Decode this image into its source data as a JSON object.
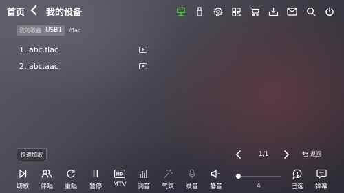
{
  "header": {
    "home_label": "首页",
    "page_title": "我的设备",
    "top_icons": [
      "usb-device-icon",
      "usb-stick-icon",
      "settings-icon",
      "qrcode-icon",
      "cart-icon",
      "download-box-icon",
      "mail-icon",
      "search-icon",
      "power-icon"
    ],
    "active_icon_color": "#4cd137"
  },
  "breadcrumb": {
    "seg1": "我的歌曲",
    "seg2": "USB1",
    "path": "/flac"
  },
  "files": [
    {
      "label": "1.  abc.flac"
    },
    {
      "label": "2.  abc.aac"
    }
  ],
  "quick_add": "快速加歌",
  "pager": {
    "text": "1/1"
  },
  "back_label": "返回",
  "bottom_bar": {
    "items": [
      {
        "label": "切歌",
        "icon": "next-track-icon"
      },
      {
        "label": "伴唱",
        "icon": "duet-icon"
      },
      {
        "label": "重唱",
        "icon": "replay-icon"
      },
      {
        "label": "暂停",
        "icon": "pause-icon"
      },
      {
        "label": "MTV",
        "icon": "hd-icon"
      },
      {
        "label": "调音",
        "icon": "equalizer-icon"
      },
      {
        "label": "气氛",
        "icon": "magic-wand-icon"
      },
      {
        "label": "录音",
        "icon": "microphone-icon"
      },
      {
        "label": "静音",
        "icon": "mute-icon"
      }
    ],
    "volume": {
      "value": "4",
      "accent": "#e05555"
    },
    "selected_label": "已选",
    "selected_icon": "selected-list-icon",
    "danmaku_label": "弹幕",
    "danmaku_icon": "danmaku-icon"
  }
}
